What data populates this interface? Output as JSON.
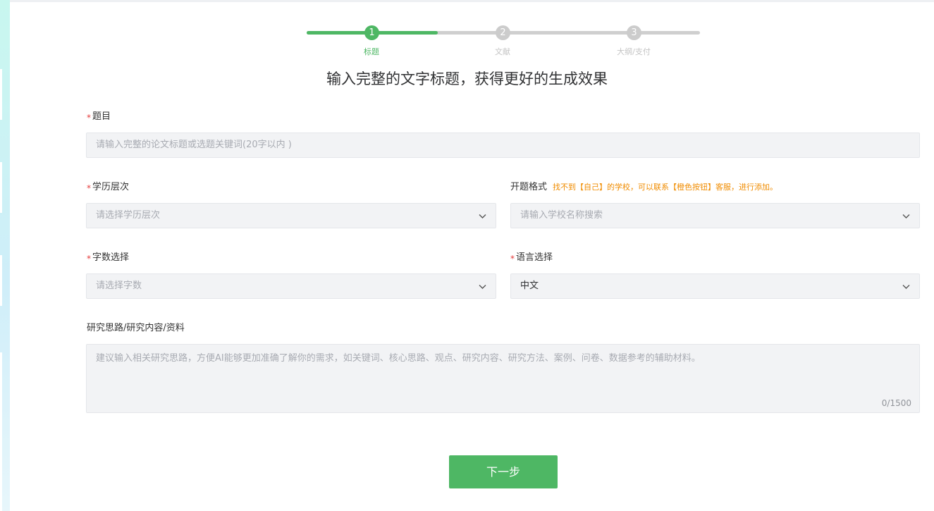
{
  "stepper": {
    "steps": [
      {
        "number": "1",
        "label": "标题"
      },
      {
        "number": "2",
        "label": "文献"
      },
      {
        "number": "3",
        "label": "大纲/支付"
      }
    ],
    "active_color": "#4eb764",
    "inactive_color": "#cccccc"
  },
  "headline": "输入完整的文字标题，获得更好的生成效果",
  "form": {
    "required_mark": "*",
    "title": {
      "label": "题目",
      "placeholder": "请输入完整的论文标题或选题关键词(20字以内 )"
    },
    "education": {
      "label": "学历层次",
      "placeholder": "请选择学历层次"
    },
    "proposal_format": {
      "label": "开题格式",
      "note": "找不到【自己】的学校，可以联系【橙色按钮】客服，进行添加。",
      "placeholder": "请输入学校名称搜索"
    },
    "word_count": {
      "label": "字数选择",
      "placeholder": "请选择字数"
    },
    "language": {
      "label": "语言选择",
      "value": "中文"
    },
    "research": {
      "label": "研究思路/研究内容/资料",
      "placeholder": "建议输入相关研究思路，方便AI能够更加准确了解你的需求，如关键词、核心思路、观点、研究内容、研究方法、案例、问卷、数据参考的辅助材料。",
      "counter": "0/1500"
    }
  },
  "next_button": "下一步",
  "colors": {
    "primary": "#4eb764",
    "required": "#e53b3b",
    "note": "#f08c00"
  }
}
